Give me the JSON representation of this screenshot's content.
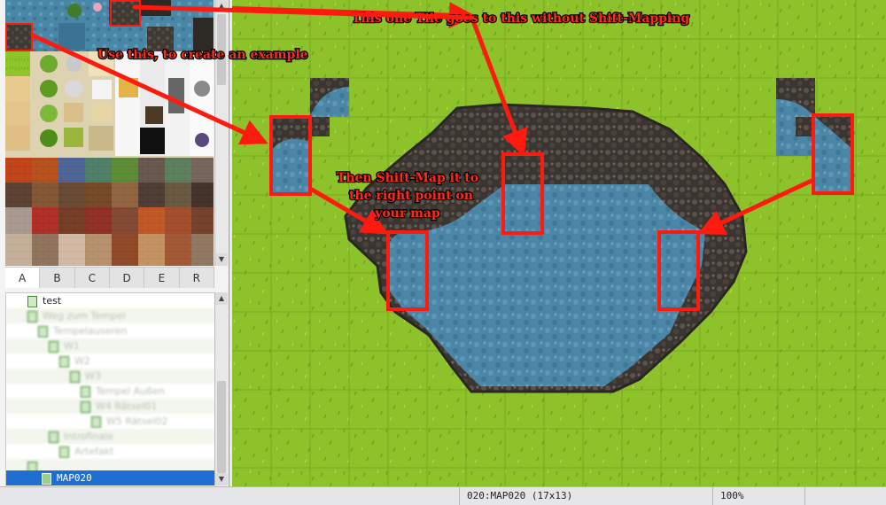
{
  "tabs": [
    "A",
    "B",
    "C",
    "D",
    "E",
    "R"
  ],
  "active_tab": "A",
  "tree": {
    "items": [
      {
        "label": "test",
        "level": 1,
        "blur": false
      },
      {
        "label": "Weg zum Tempel",
        "level": 1,
        "blur": true
      },
      {
        "label": "Tempelauseren",
        "level": 2,
        "blur": true
      },
      {
        "label": "W1",
        "level": 3,
        "blur": true
      },
      {
        "label": "W2",
        "level": 4,
        "blur": true
      },
      {
        "label": "W3",
        "level": 5,
        "blur": true
      },
      {
        "label": "Tempel Außen",
        "level": 6,
        "blur": true
      },
      {
        "label": "W4 Rätsel01",
        "level": 6,
        "blur": true
      },
      {
        "label": "W5 Rätsel02",
        "level": 7,
        "blur": true
      },
      {
        "label": "Introfinale",
        "level": 3,
        "blur": true
      },
      {
        "label": "Artefakt",
        "level": 4,
        "blur": true
      },
      {
        "label": "",
        "level": 1,
        "blur": true
      }
    ],
    "selected": "MAP020"
  },
  "annotations": {
    "top": "This one Tile goes to this without Shift-Mapping",
    "left": "Use this, to create an example",
    "middle": [
      "Then Shift-Map it to",
      "the right point on",
      "your map"
    ]
  },
  "status": {
    "map_info": "020:MAP020 (17x13)",
    "zoom": "100%"
  },
  "colors": {
    "annotation": "#ff1a10",
    "water": "#4b86a6",
    "grass": "#8fc42a",
    "cliff": "#3e3933",
    "selection": "#1e6fd1"
  }
}
